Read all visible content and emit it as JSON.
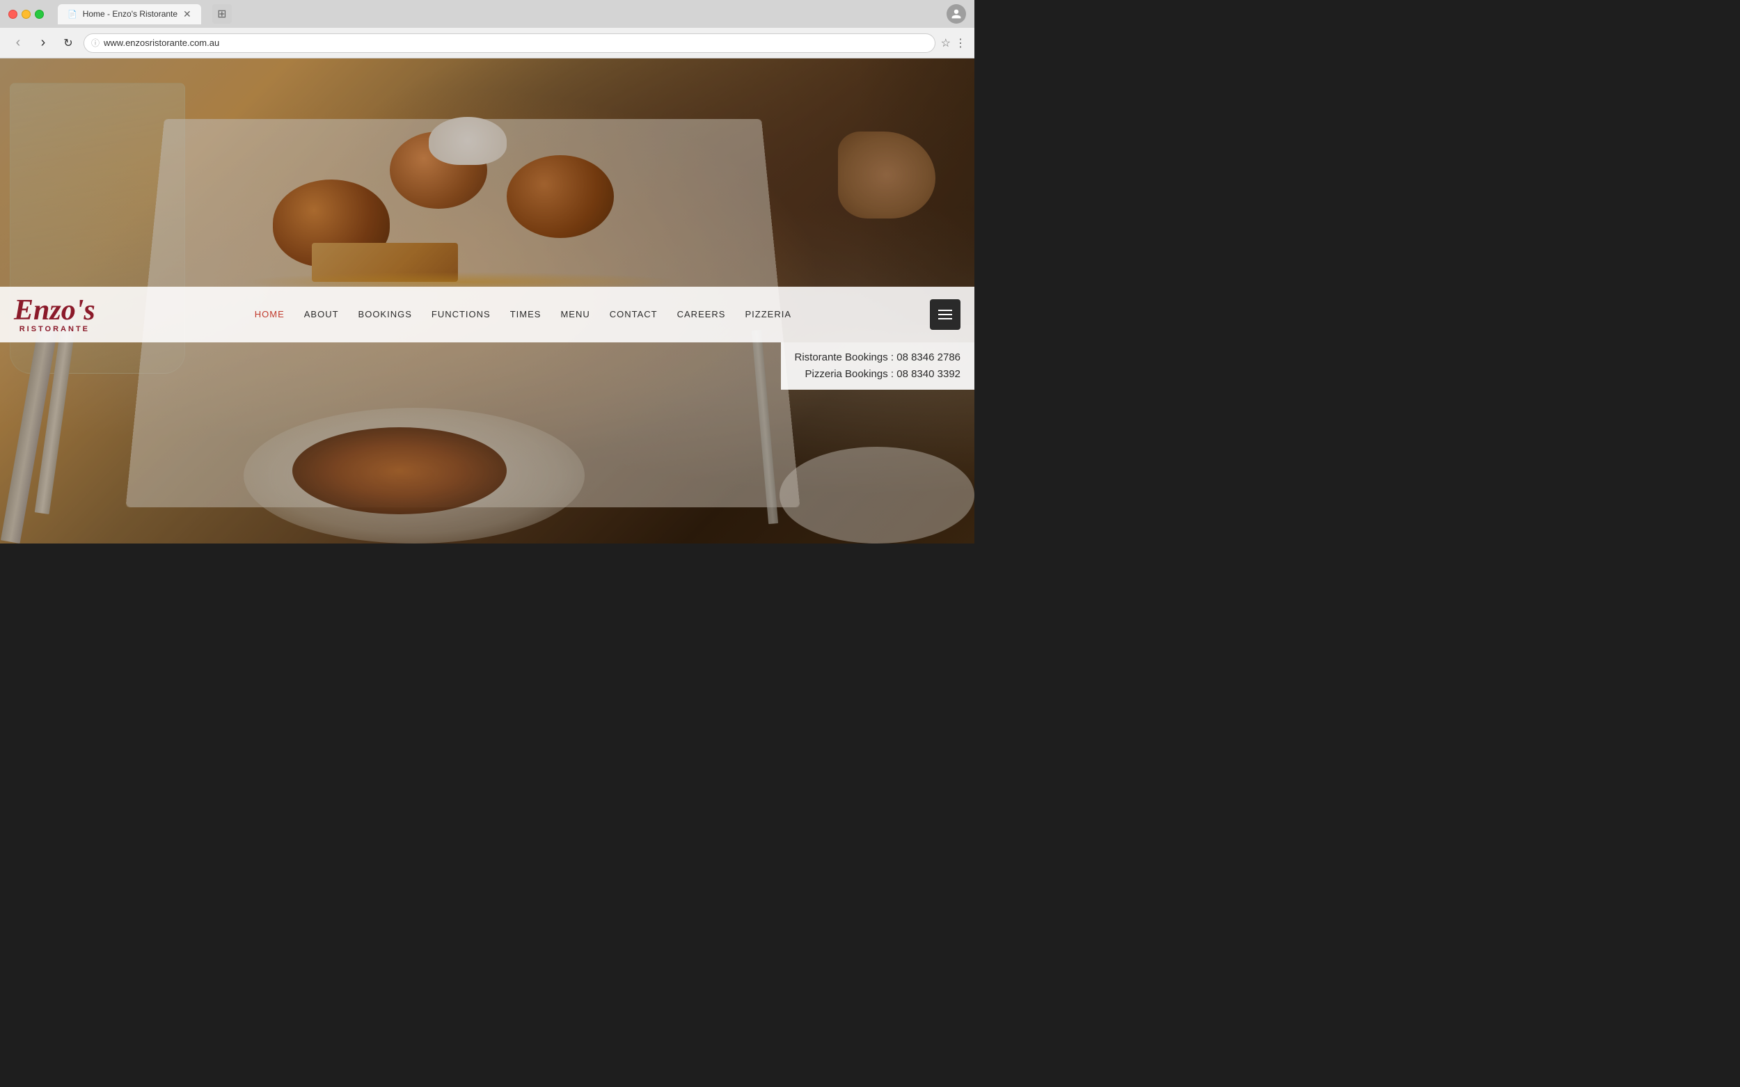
{
  "browser": {
    "tab_title": "Home - Enzo's Ristorante",
    "url": "www.enzosristorante.com.au",
    "back_label": "‹",
    "forward_label": "›",
    "refresh_label": "↻"
  },
  "website": {
    "logo": {
      "main": "Enzo's",
      "sub": "RISTORANTE"
    },
    "nav": {
      "items": [
        {
          "label": "HOME",
          "active": true
        },
        {
          "label": "ABOUT",
          "active": false
        },
        {
          "label": "BOOKINGS",
          "active": false
        },
        {
          "label": "FUNCTIONS",
          "active": false
        },
        {
          "label": "TIMES",
          "active": false
        },
        {
          "label": "MENU",
          "active": false
        },
        {
          "label": "CONTACT",
          "active": false
        },
        {
          "label": "CAREERS",
          "active": false
        },
        {
          "label": "PIZZERIA",
          "active": false
        }
      ]
    },
    "bookings": {
      "ristorante": "Ristorante Bookings : 08 8346 2786",
      "pizzeria": "Pizzeria Bookings : 08 8340 3392"
    }
  }
}
